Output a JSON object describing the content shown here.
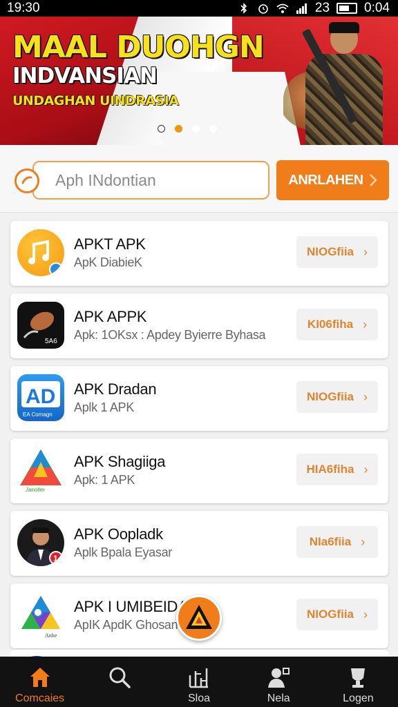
{
  "status_bar": {
    "time": "19:30",
    "signal_text": "23",
    "clock_right": "0:04"
  },
  "banner": {
    "title": "MAAL DUOHGN",
    "subtitle": "INDVANSIAN",
    "tagline": "UNDAGHAN UINDRASIA",
    "dots": 4,
    "active_dot": 1
  },
  "search": {
    "placeholder": "Aph INdontian",
    "button_label": "ANRLAHEN"
  },
  "apps": [
    {
      "name": "APKT APK",
      "sub": "ApK DiabieK",
      "button": "NIOGfiia",
      "icon": "music-app-icon"
    },
    {
      "name": "APK APPK",
      "sub": "Apk: 1OKsx : Apdey Byierre Byhasa",
      "button": "KI06fiha",
      "icon": "fist-app-icon"
    },
    {
      "name": "APK Dradan",
      "sub": "Aplk 1 APK",
      "button": "NIOGfiia",
      "icon": "ad-app-icon"
    },
    {
      "name": "APK Shagiiga",
      "sub": "Apk: 1 APK",
      "button": "HIA6fiha",
      "icon": "drive-app-icon"
    },
    {
      "name": "APK Oopladk",
      "sub": "Aplk Bpala Eyasar",
      "button": "NIa6fiia",
      "icon": "person-app-icon"
    },
    {
      "name": "APK I UMIBEIDAE",
      "sub": "ApIK ApdK Ghosan",
      "button": "NIOGfiia",
      "icon": "triangle-app-icon"
    }
  ],
  "nav": [
    {
      "label": "Comcaies",
      "icon": "home-icon",
      "active": true
    },
    {
      "label": "",
      "icon": "search-icon",
      "active": false
    },
    {
      "label": "Sloa",
      "icon": "chart-icon",
      "active": false
    },
    {
      "label": "Nela",
      "icon": "profile-icon",
      "active": false
    },
    {
      "label": "Logen",
      "icon": "trophy-icon",
      "active": false
    }
  ],
  "colors": {
    "accent": "#f07d1a",
    "banner_yellow": "#f6e11a",
    "nav_bg": "#121212"
  }
}
